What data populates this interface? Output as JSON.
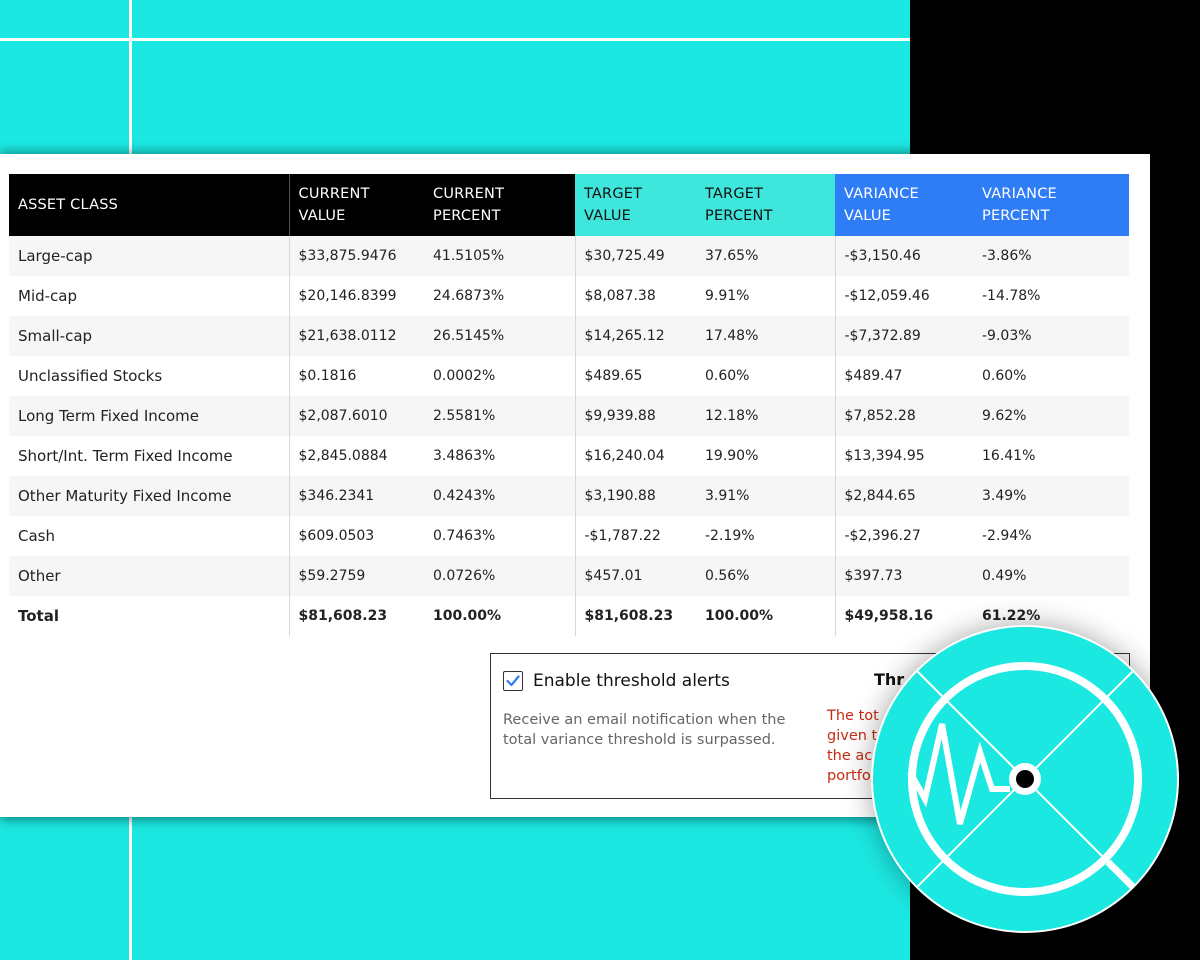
{
  "colors": {
    "background_accent": "#1ce8e2",
    "current_header": "#000000",
    "target_header": "#3fe6dc",
    "variance_header": "#2e7cf6",
    "warning_text": "#c62a12",
    "checkbox_check": "#2e7cf6"
  },
  "table": {
    "headers": {
      "asset_class": "ASSET CLASS",
      "current_value": [
        "CURRENT",
        "VALUE"
      ],
      "current_percent": [
        "CURRENT",
        "PERCENT"
      ],
      "target_value": [
        "TARGET",
        "VALUE"
      ],
      "target_percent": [
        "TARGET",
        "PERCENT"
      ],
      "variance_value": [
        "VARIANCE",
        "VALUE"
      ],
      "variance_percent": [
        "VARIANCE",
        "PERCENT"
      ]
    },
    "rows": [
      {
        "asset": "Large-cap",
        "current_value": "$33,875.9476",
        "current_percent": "41.5105%",
        "target_value": "$30,725.49",
        "target_percent": "37.65%",
        "variance_value": "-$3,150.46",
        "variance_percent": "-3.86%"
      },
      {
        "asset": "Mid-cap",
        "current_value": "$20,146.8399",
        "current_percent": "24.6873%",
        "target_value": "$8,087.38",
        "target_percent": "9.91%",
        "variance_value": "-$12,059.46",
        "variance_percent": "-14.78%"
      },
      {
        "asset": "Small-cap",
        "current_value": "$21,638.0112",
        "current_percent": "26.5145%",
        "target_value": "$14,265.12",
        "target_percent": "17.48%",
        "variance_value": "-$7,372.89",
        "variance_percent": "-9.03%"
      },
      {
        "asset": "Unclassified Stocks",
        "current_value": "$0.1816",
        "current_percent": "0.0002%",
        "target_value": "$489.65",
        "target_percent": "0.60%",
        "variance_value": "$489.47",
        "variance_percent": "0.60%"
      },
      {
        "asset": "Long Term Fixed Income",
        "current_value": "$2,087.6010",
        "current_percent": "2.5581%",
        "target_value": "$9,939.88",
        "target_percent": "12.18%",
        "variance_value": "$7,852.28",
        "variance_percent": "9.62%"
      },
      {
        "asset": "Short/Int. Term Fixed Income",
        "current_value": "$2,845.0884",
        "current_percent": "3.4863%",
        "target_value": "$16,240.04",
        "target_percent": "19.90%",
        "variance_value": "$13,394.95",
        "variance_percent": "16.41%"
      },
      {
        "asset": "Other Maturity Fixed Income",
        "current_value": "$346.2341",
        "current_percent": "0.4243%",
        "target_value": "$3,190.88",
        "target_percent": "3.91%",
        "variance_value": "$2,844.65",
        "variance_percent": "3.49%"
      },
      {
        "asset": "Cash",
        "current_value": "$609.0503",
        "current_percent": "0.7463%",
        "target_value": "-$1,787.22",
        "target_percent": "-2.19%",
        "variance_value": "-$2,396.27",
        "variance_percent": "-2.94%"
      },
      {
        "asset": "Other",
        "current_value": "$59.2759",
        "current_percent": "0.0726%",
        "target_value": "$457.01",
        "target_percent": "0.56%",
        "variance_value": "$397.73",
        "variance_percent": "0.49%"
      }
    ],
    "total": {
      "asset": "Total",
      "current_value": "$81,608.23",
      "current_percent": "100.00%",
      "target_value": "$81,608.23",
      "target_percent": "100.00%",
      "variance_value": "$49,958.16",
      "variance_percent": "61.22%"
    }
  },
  "threshold": {
    "checkbox_label": "Enable threshold alerts",
    "checkbox_checked": true,
    "description": "Receive an email notification when the total variance threshold is surpassed.",
    "title_partial": "Thr",
    "warning_lines": [
      "The tot",
      "given t",
      "the ac",
      "portfo"
    ]
  },
  "logo": {
    "icon": "radar-pulse-icon"
  }
}
